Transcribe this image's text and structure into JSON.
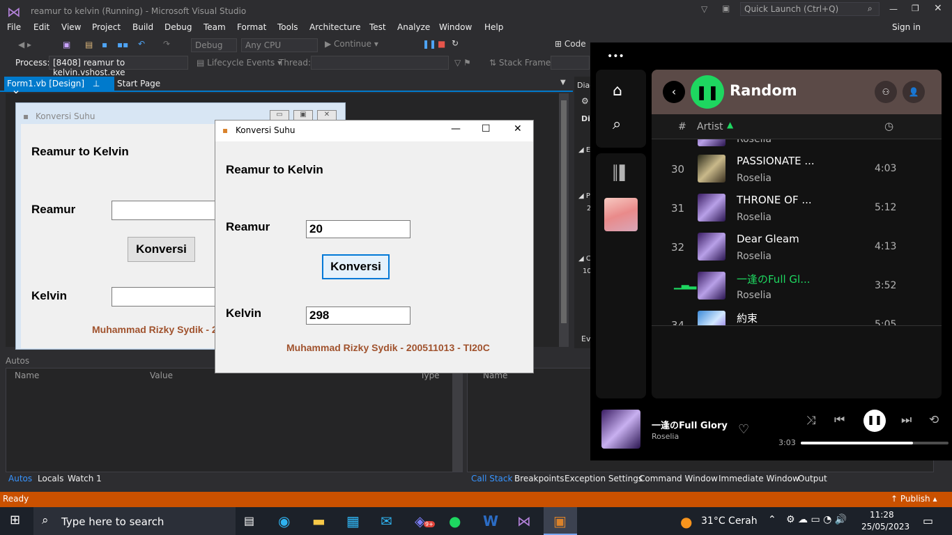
{
  "vs": {
    "title": "reamur to kelvin (Running) - Microsoft Visual Studio",
    "quick_launch": "Quick Launch (Ctrl+Q)",
    "sign_in": "Sign in",
    "menu": [
      "File",
      "Edit",
      "View",
      "Project",
      "Build",
      "Debug",
      "Team",
      "Format",
      "Tools",
      "Architecture",
      "Test",
      "Analyze",
      "Window",
      "Help"
    ],
    "toolbar": {
      "config": "Debug",
      "platform": "Any CPU",
      "continue": "Continue",
      "code": "Code"
    },
    "process_label": "Process:",
    "process_value": "[8408] reamur to kelvin.vshost.exe",
    "lifecycle": "Lifecycle Events",
    "thread_label": "Thread:",
    "stack_frame": "Stack Frame:",
    "tabs": {
      "active": "Form1.vb [Design]",
      "start": "Start Page"
    },
    "right_labels": [
      "Diag",
      "Dia",
      "E",
      "P",
      "2",
      "C",
      "10",
      "Ev"
    ],
    "autos": {
      "title": "Autos",
      "cols": [
        "Name",
        "Value",
        "Type"
      ]
    },
    "right_panel_col": "Name",
    "bottom_tabs_left": [
      "Autos",
      "Locals",
      "Watch 1"
    ],
    "bottom_tabs_right": [
      "Call Stack",
      "Breakpoints",
      "Exception Settings",
      "Command Window",
      "Immediate Window",
      "Output"
    ],
    "status": "Ready",
    "publish": "Publish"
  },
  "designer_form": {
    "title": "Konversi Suhu",
    "heading": "Reamur to Kelvin",
    "reamur_label": "Reamur",
    "button": "Konversi",
    "kelvin_label": "Kelvin",
    "credit": "Muhammad Rizky Sydik - 2"
  },
  "popup": {
    "title": "Konversi Suhu",
    "heading": "Reamur to Kelvin",
    "reamur_label": "Reamur",
    "reamur_value": "20",
    "button": "Konversi",
    "kelvin_label": "Kelvin",
    "kelvin_value": "298",
    "credit": "Muhammad Rizky Sydik - 200511013 - TI20C"
  },
  "spotify": {
    "dots": "•••",
    "playlist": "Random",
    "col_num": "#",
    "col_artist": "Artist",
    "rows": [
      {
        "num": "",
        "title": "",
        "artist": "Roselia",
        "time": ""
      },
      {
        "num": "30",
        "title": "PASSIONATE ...",
        "artist": "Roselia",
        "time": "4:03"
      },
      {
        "num": "31",
        "title": "THRONE OF ...",
        "artist": "Roselia",
        "time": "5:12"
      },
      {
        "num": "32",
        "title": "Dear Gleam",
        "artist": "Roselia",
        "time": "4:13"
      },
      {
        "num": "",
        "title": "一逢のFull Gl...",
        "artist": "Roselia",
        "time": "3:52"
      },
      {
        "num": "34",
        "title": "約束",
        "artist": "",
        "time": "5:05"
      }
    ],
    "now_playing": {
      "title": "一逢のFull Glory",
      "artist": "Roselia",
      "elapsed": "3:03",
      "progress": 0.76
    },
    "accent": "#1ed760"
  },
  "taskbar": {
    "search": "Type here to search",
    "weather": "31°C  Cerah",
    "time": "11:28",
    "date": "25/05/2023",
    "badge": "9+"
  }
}
